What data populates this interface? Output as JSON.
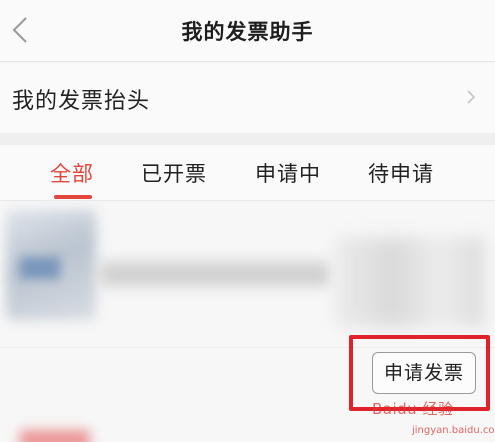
{
  "nav": {
    "title": "我的发票助手",
    "back_icon": "chevron-left-icon"
  },
  "header_row": {
    "label": "我的发票抬头",
    "icon": "chevron-right-icon"
  },
  "tabs": [
    {
      "label": "全部",
      "active": true
    },
    {
      "label": "已开票",
      "active": false
    },
    {
      "label": "申请中",
      "active": false
    },
    {
      "label": "待申请",
      "active": false
    }
  ],
  "order": {
    "apply_label": "申请发票"
  },
  "watermark": {
    "text": "Baidu 经验",
    "sub": "jingyan.baidu.com"
  },
  "colors": {
    "accent": "#e2453c",
    "highlight": "#e0232b"
  }
}
